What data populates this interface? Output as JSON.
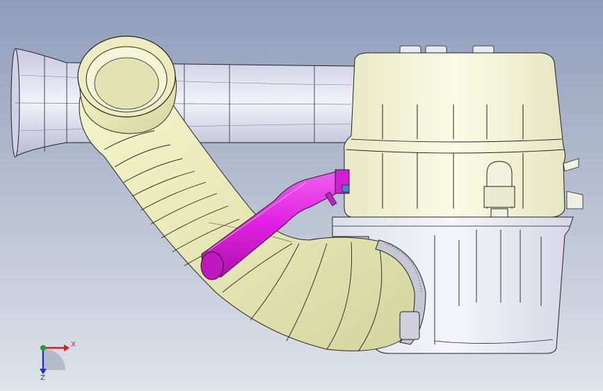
{
  "viewport": {
    "background_top": "#8f9dbb",
    "background_bottom": "#dfe3ea"
  },
  "model": {
    "duct_color": "#dcdcee",
    "hose_color": "#ececbc",
    "pipe_color": "#e020e0",
    "housing_color": "#f4f4d4",
    "lower_box_color": "#e8e8f0",
    "clamp_color": "#b8b8c8"
  },
  "triad": {
    "x_label": "X",
    "z_label": "Z",
    "x_color": "#d02020",
    "y_color": "#20a020",
    "z_color": "#2030c0"
  }
}
